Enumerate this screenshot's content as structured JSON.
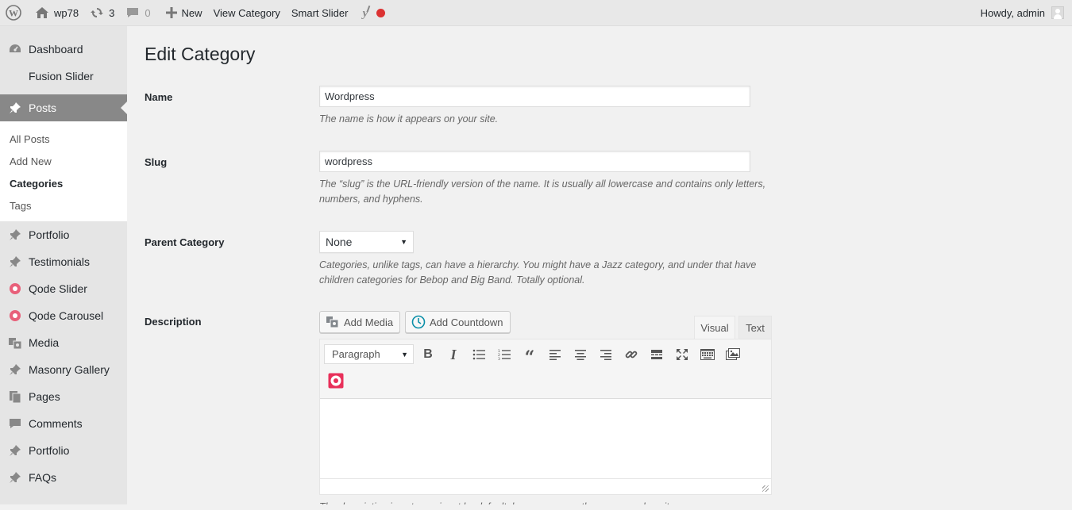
{
  "adminbar": {
    "site_name": "wp78",
    "updates_count": "3",
    "comments_count": "0",
    "new_label": "New",
    "view_category": "View Category",
    "smart_slider": "Smart Slider",
    "howdy": "Howdy, admin"
  },
  "sidebar": {
    "items_top": [
      {
        "label": "Dashboard",
        "icon": "dashboard-icon"
      },
      {
        "label": "Fusion Slider",
        "icon": ""
      }
    ],
    "current": {
      "label": "Posts",
      "icon": "pin-icon"
    },
    "submenu": [
      "All Posts",
      "Add New",
      "Categories",
      "Tags"
    ],
    "items_bottom": [
      {
        "label": "Portfolio",
        "icon": "pin-icon"
      },
      {
        "label": "Testimonials",
        "icon": "pin-icon"
      },
      {
        "label": "Qode Slider",
        "icon": "qode-icon"
      },
      {
        "label": "Qode Carousel",
        "icon": "qode-icon"
      },
      {
        "label": "Media",
        "icon": "media-icon"
      },
      {
        "label": "Masonry Gallery",
        "icon": "pin-icon"
      },
      {
        "label": "Pages",
        "icon": "pages-icon"
      },
      {
        "label": "Comments",
        "icon": "comment-icon"
      },
      {
        "label": "Portfolio",
        "icon": "pin-icon"
      },
      {
        "label": "FAQs",
        "icon": "pin-icon"
      }
    ]
  },
  "main": {
    "title": "Edit Category",
    "name": {
      "label": "Name",
      "value": "Wordpress",
      "desc": "The name is how it appears on your site."
    },
    "slug": {
      "label": "Slug",
      "value": "wordpress",
      "desc": "The “slug” is the URL-friendly version of the name. It is usually all lowercase and contains only letters, numbers, and hyphens."
    },
    "parent": {
      "label": "Parent Category",
      "value": "None",
      "desc": "Categories, unlike tags, can have a hierarchy. You might have a Jazz category, and under that have children categories for Bebop and Big Band. Totally optional."
    },
    "description": {
      "label": "Description",
      "add_media": "Add Media",
      "add_countdown": "Add Countdown",
      "tab_visual": "Visual",
      "tab_text": "Text",
      "format": "Paragraph",
      "footer_text": "The description is not prominent by default; however, some themes may show it."
    }
  }
}
